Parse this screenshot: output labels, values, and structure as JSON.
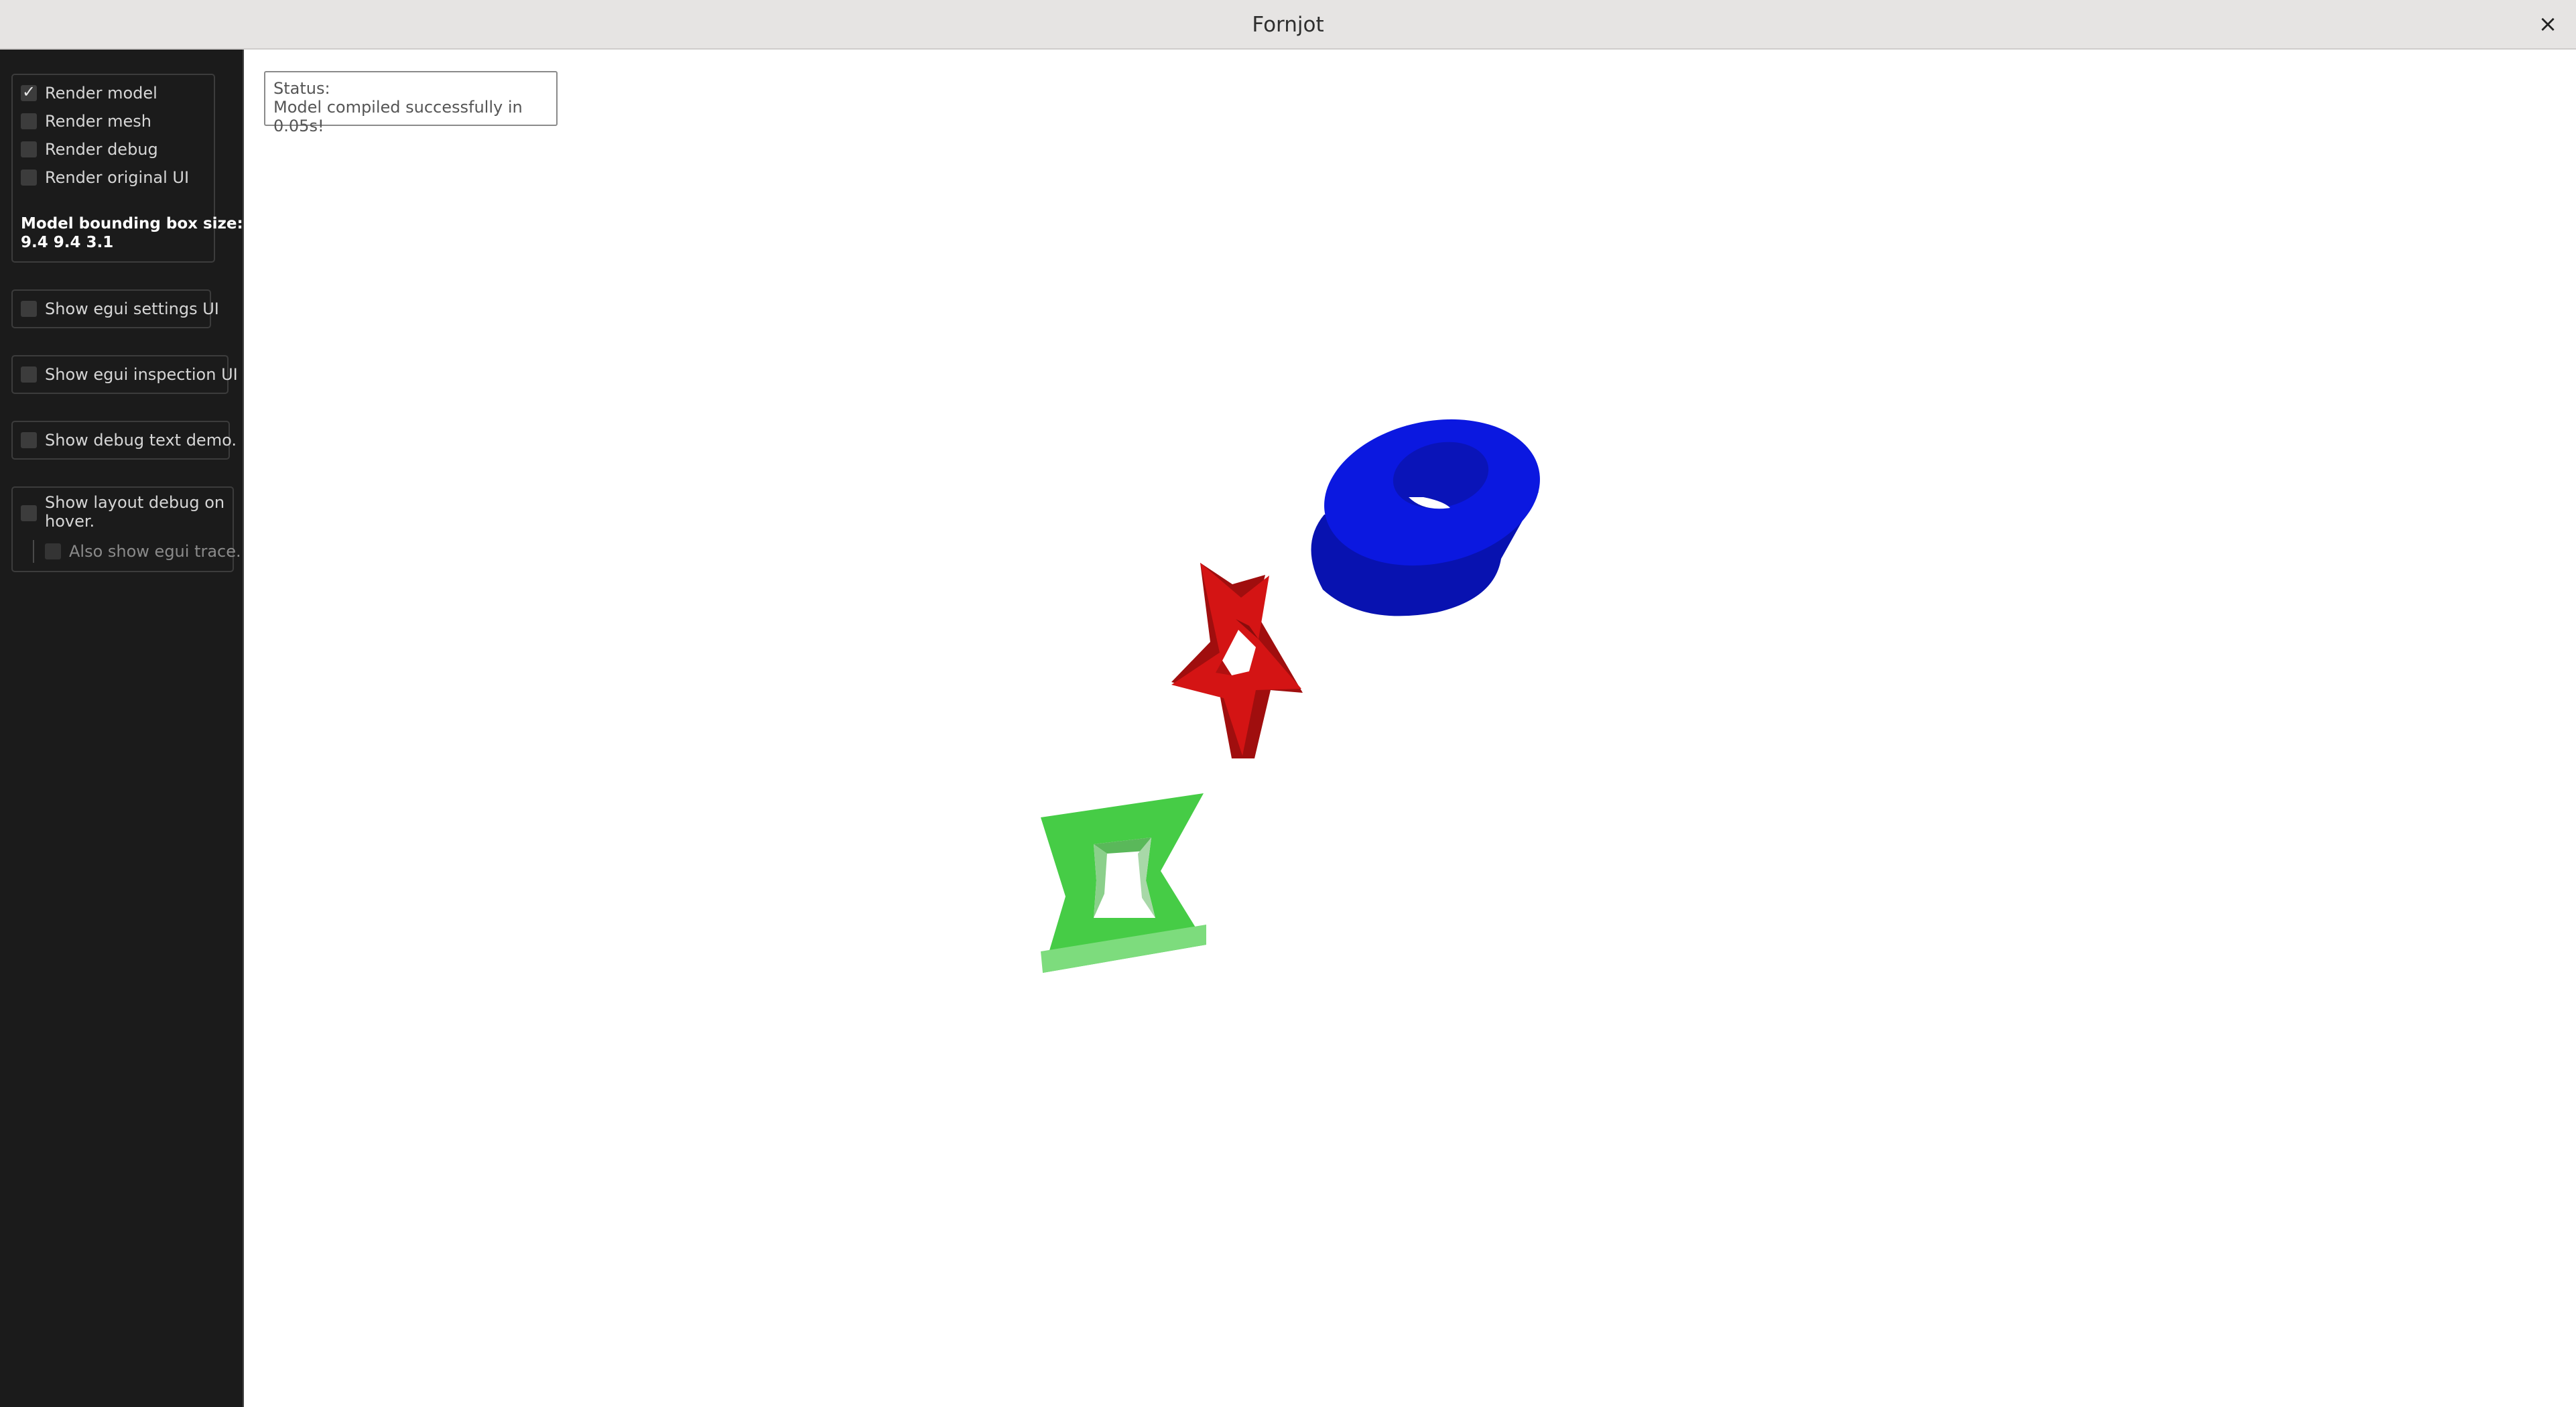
{
  "window": {
    "title": "Fornjot",
    "close_glyph": "×"
  },
  "sidebar": {
    "render_options": [
      {
        "label": "Render model",
        "checked": true
      },
      {
        "label": "Render mesh",
        "checked": false
      },
      {
        "label": "Render debug",
        "checked": false
      },
      {
        "label": "Render original UI",
        "checked": false
      }
    ],
    "bbox_label": "Model bounding box size:",
    "bbox_value": "9.4 9.4 3.1",
    "show_egui_settings": "Show egui settings UI",
    "show_egui_inspection": "Show egui inspection UI",
    "show_debug_text_demo": "Show debug text demo.",
    "show_layout_debug_line1": "Show layout debug on",
    "show_layout_debug_line2": "hover.",
    "also_show_egui_trace": "Also show egui trace."
  },
  "status": {
    "line1": "Status:",
    "line2": "Model compiled successfully in 0.05s!"
  },
  "colors": {
    "ring": "#0a14d8",
    "star": "#d61616",
    "four_point_star": "#3cc83c"
  }
}
